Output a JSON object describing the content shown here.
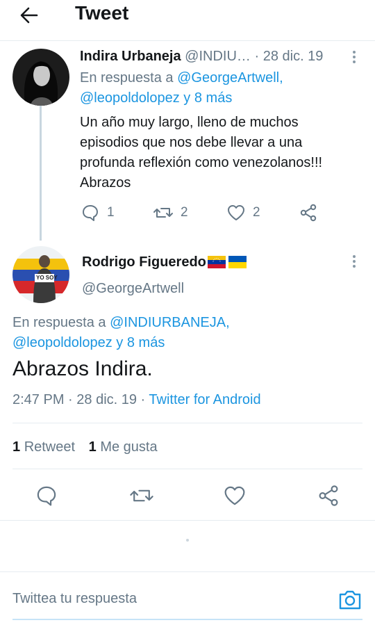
{
  "header": {
    "title": "Tweet"
  },
  "reply_tweet": {
    "name": "Indira Urbaneja",
    "handle": "@INDIU…",
    "separator": " · ",
    "date": "28 dic. 19",
    "reply_prefix": "En respuesta a ",
    "reply_user1": "@GeorgeArtwell,",
    "reply_user2": "@leopoldolopez y 8 más",
    "text_lines": [
      "Un año muy largo, lleno de muchos",
      "episodios que nos debe llevar a una",
      "profunda reflexión como venezolanos!!!",
      "Abrazos"
    ],
    "reply_count": "1",
    "retweet_count": "2",
    "like_count": "2"
  },
  "main_tweet": {
    "name": "Rodrigo Figueredo",
    "handle": "@GeorgeArtwell",
    "reply_prefix": "En respuesta a ",
    "reply_user1": "@INDIURBANEJA,",
    "reply_user2": "@leopoldolopez y 8 más",
    "text": "Abrazos Indira.",
    "time": "2:47 PM",
    "date": "28 dic. 19",
    "separator": " · ",
    "source": "Twitter for Android",
    "retweets_count": "1",
    "retweets_label": "Retweet",
    "likes_count": "1",
    "likes_label": "Me gusta",
    "avatar_banner_text": "YO SOY"
  },
  "compose": {
    "placeholder": "Twittea tu respuesta"
  },
  "colors": {
    "accent": "#1b95e0",
    "text": "#14171a",
    "muted": "#657786",
    "divider": "#e6ecf0"
  }
}
